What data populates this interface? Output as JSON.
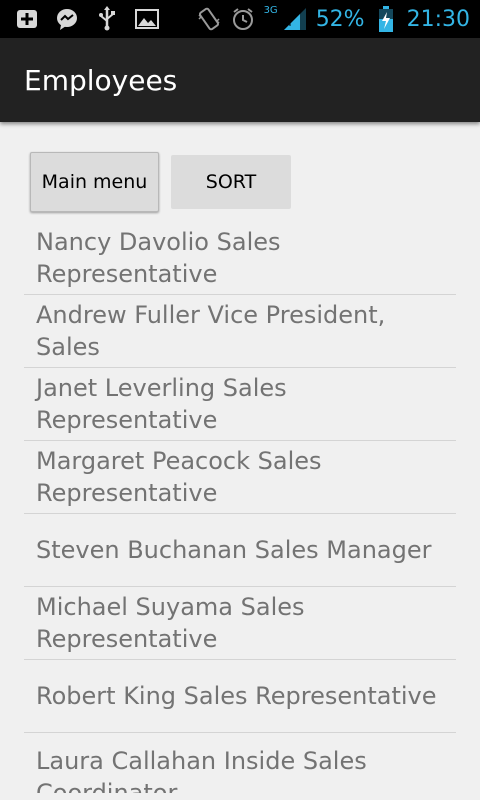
{
  "status_bar": {
    "icons_left": [
      "add-icon",
      "messenger-icon",
      "usb-icon",
      "image-icon"
    ],
    "icons_right": [
      "vibrate-icon",
      "alarm-icon",
      "signal-icon",
      "battery-icon"
    ],
    "network_label": "3G",
    "battery": "52%",
    "time": "21:30",
    "accent_color": "#33b5e5"
  },
  "action_bar": {
    "title": "Employees",
    "background_color": "#222222"
  },
  "buttons": {
    "main_menu": "Main menu",
    "sort": "SORT"
  },
  "employees": [
    "Nancy Davolio Sales Representative",
    "Andrew Fuller Vice President, Sales",
    "Janet Leverling Sales Representative",
    "Margaret Peacock Sales Representative",
    "Steven Buchanan Sales Manager",
    "Michael Suyama Sales Representative",
    "Robert King Sales Representative",
    "Laura Callahan Inside Sales Coordinator"
  ]
}
